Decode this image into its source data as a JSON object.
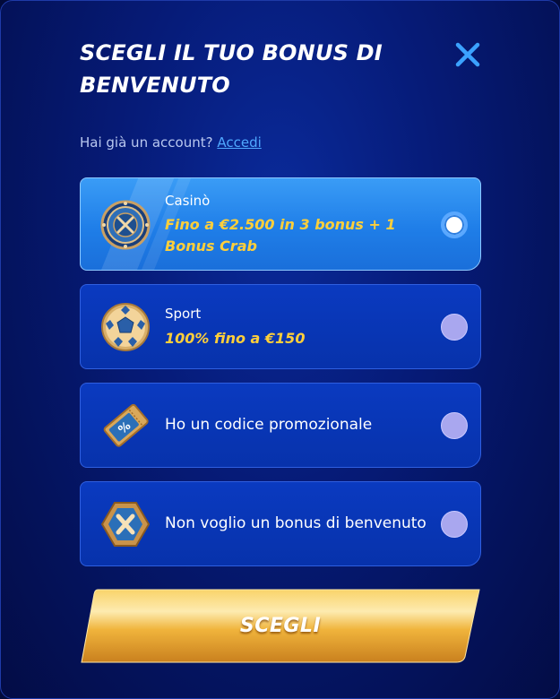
{
  "modal": {
    "title": "SCEGLI IL TUO BONUS DI BENVENUTO",
    "account_prompt": "Hai già un account?",
    "login_link": "Accedi"
  },
  "options": [
    {
      "label": "Casinò",
      "subtitle": "Fino a €2.500 in 3 bonus + 1 Bonus Crab",
      "icon": "casino-chip-icon",
      "selected": true
    },
    {
      "label": "Sport",
      "subtitle": "100% fino a €150",
      "icon": "soccer-ball-icon",
      "selected": false
    },
    {
      "label": "Ho un codice promozionale",
      "icon": "promo-ticket-icon",
      "selected": false
    },
    {
      "label": "Non voglio un bonus di benvenuto",
      "icon": "no-bonus-x-icon",
      "selected": false
    }
  ],
  "submit_label": "SCEGLI",
  "colors": {
    "accent_blue": "#4fa8ff",
    "highlight_yellow": "#ffcf3a",
    "button_gold": "#f2b233"
  }
}
